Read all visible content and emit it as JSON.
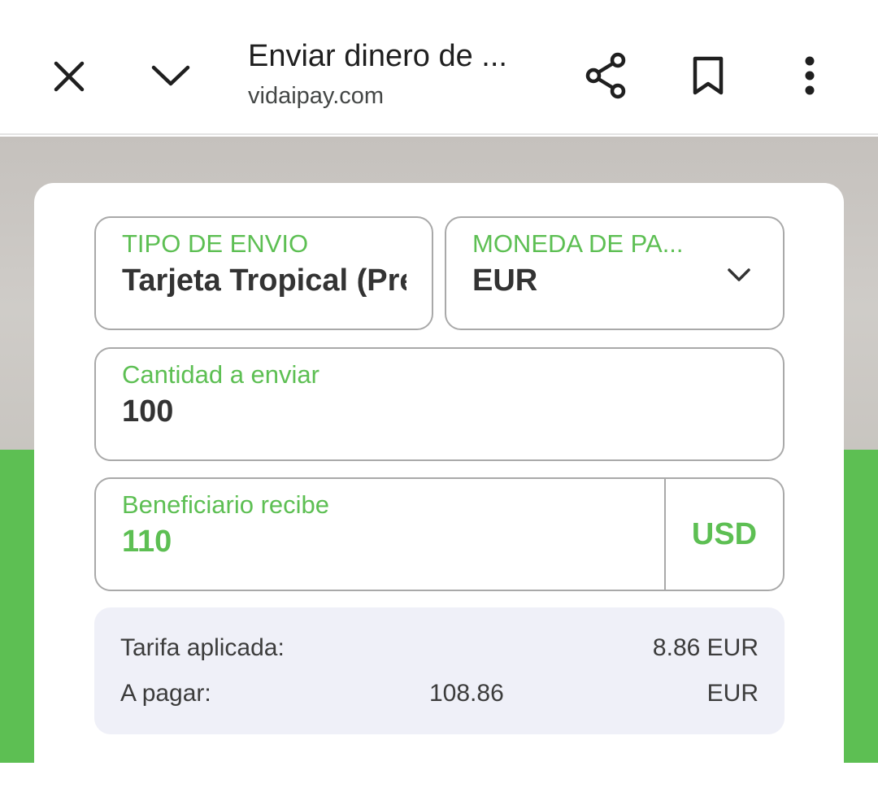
{
  "browser": {
    "title": "Enviar dinero de ...",
    "url": "vidaipay.com",
    "icons": {
      "close": "close-icon",
      "minimize": "chevron-down-icon",
      "share": "share-icon",
      "bookmark": "bookmark-icon",
      "menu": "more-vert-icon"
    }
  },
  "form": {
    "tipo_envio": {
      "label": "TIPO DE ENVIO",
      "value": "Tarjeta Tropical (Prepago)"
    },
    "moneda_pago": {
      "label": "MONEDA DE PA...",
      "value": "EUR"
    },
    "cantidad": {
      "label": "Cantidad a enviar",
      "value": "100"
    },
    "beneficiario": {
      "label": "Beneficiario recibe",
      "value": "110",
      "currency": "USD"
    }
  },
  "summary": {
    "tarifa_label": "Tarifa aplicada:",
    "tarifa_value": "8.86 EUR",
    "pagar_label": "A pagar:",
    "pagar_amount": "108.86",
    "pagar_currency": "EUR"
  },
  "colors": {
    "accent_green": "#5dbf53",
    "text_dark": "#333333",
    "summary_bg": "#eff0f8"
  }
}
